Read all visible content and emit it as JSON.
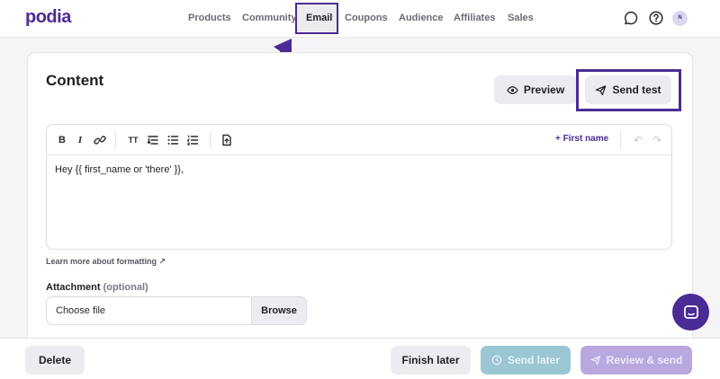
{
  "brand": {
    "logo": "podia",
    "accent": "#4b2b95"
  },
  "nav": {
    "items": [
      {
        "label": "Products"
      },
      {
        "label": "Community"
      },
      {
        "label": "Email",
        "active": true
      },
      {
        "label": "Coupons"
      },
      {
        "label": "Audience"
      },
      {
        "label": "Affiliates"
      },
      {
        "label": "Sales"
      }
    ],
    "icons": [
      "chat-bubble-icon",
      "help-icon"
    ],
    "avatar_initial": "N"
  },
  "content": {
    "title": "Content",
    "preview_label": "Preview",
    "send_test_label": "Send test"
  },
  "editor": {
    "toolbar": {
      "bold": "B",
      "italic": "I",
      "text_size": "TT",
      "insert_first_name": "+ First name"
    },
    "body_text": "Hey {{ first_name or 'there' }},"
  },
  "learn_more": "Learn more about formatting ↗",
  "attachment": {
    "label": "Attachment",
    "optional": "(optional)",
    "placeholder": "Choose file",
    "browse_label": "Browse"
  },
  "footer": {
    "delete_label": "Delete",
    "finish_later_label": "Finish later",
    "send_later_label": "Send later",
    "review_send_label": "Review & send"
  }
}
